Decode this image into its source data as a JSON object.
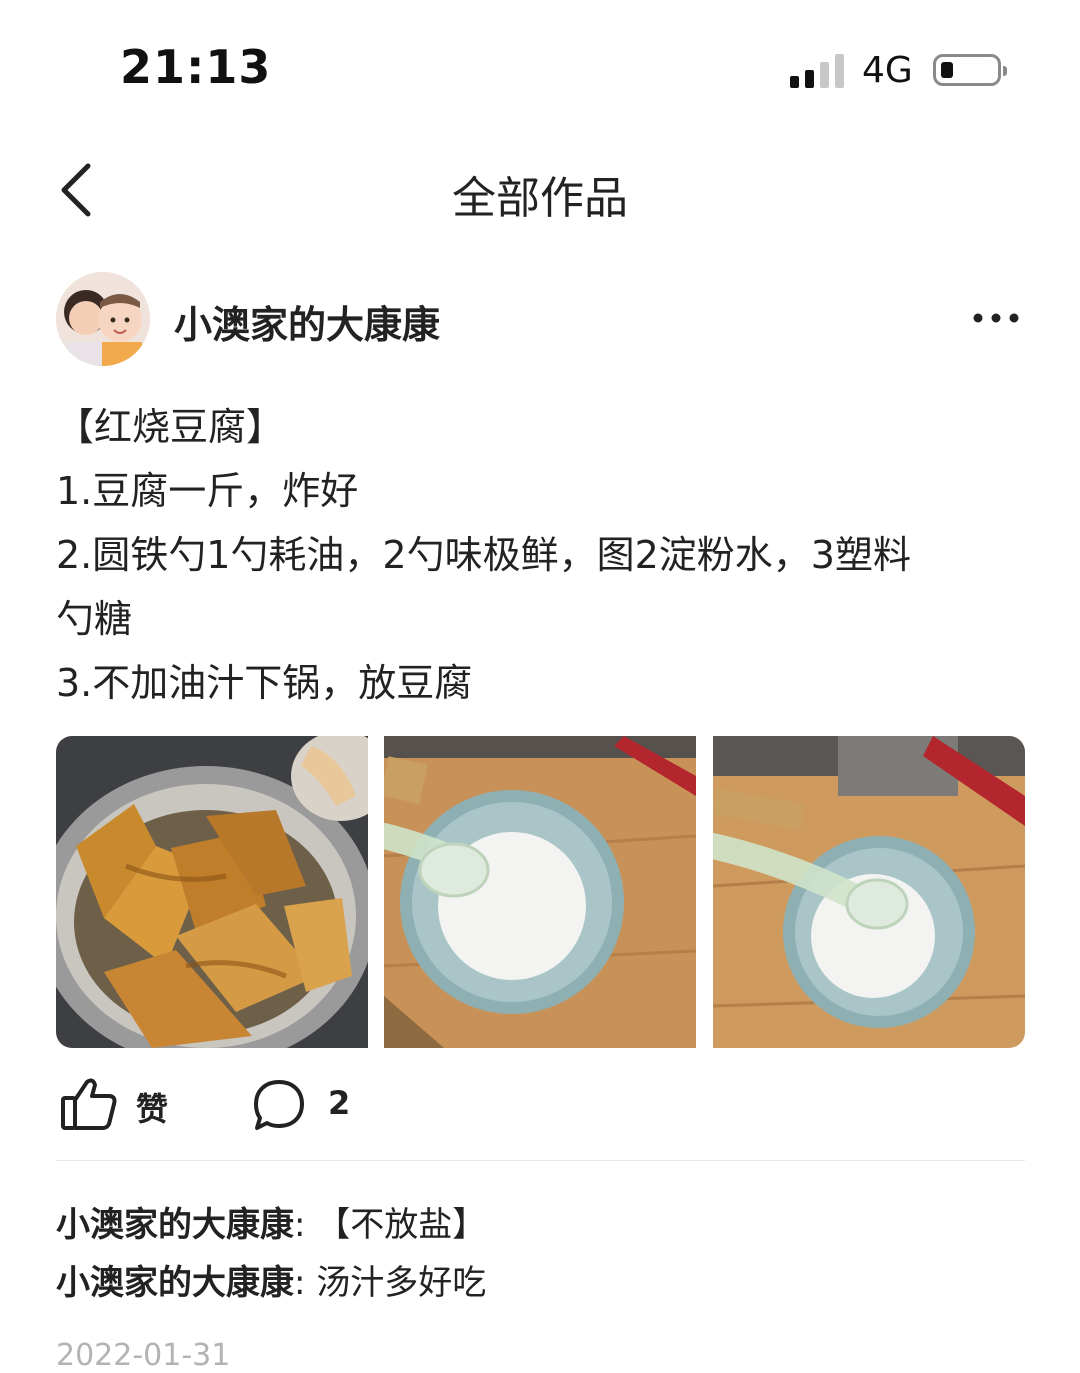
{
  "status_bar": {
    "time": "21:13",
    "network": "4G",
    "signal_bars_active": 2,
    "signal_bars_total": 4,
    "battery_level": 0.15
  },
  "nav": {
    "title": "全部作品",
    "back_icon": "chevron-left-icon"
  },
  "post": {
    "author": "小澳家的大康康",
    "more_icon": "more-dots-icon",
    "lines": [
      "【红烧豆腐】",
      "1.豆腐一斤，炸好",
      "2.圆铁勺1勺耗油，2勺味极鲜，图2淀粉水，3塑料",
      "勺糖",
      "3.不加油汁下锅，放豆腐"
    ],
    "like_label": "赞",
    "comment_count": "2",
    "date": "2022-01-31"
  },
  "comments": [
    {
      "author": "小澳家的大康康",
      "separator": ": ",
      "text": "【不放盐】"
    },
    {
      "author": "小澳家的大康康",
      "separator": ": ",
      "text": "汤汁多好吃"
    }
  ],
  "icons": [
    "chevron-left-icon",
    "more-dots-icon",
    "thumbs-up-icon",
    "comment-bubble-icon"
  ],
  "colors": {
    "text": "#222222",
    "divider": "#e6e6e6",
    "date": "#b3b3b3",
    "background": "#ffffff"
  }
}
